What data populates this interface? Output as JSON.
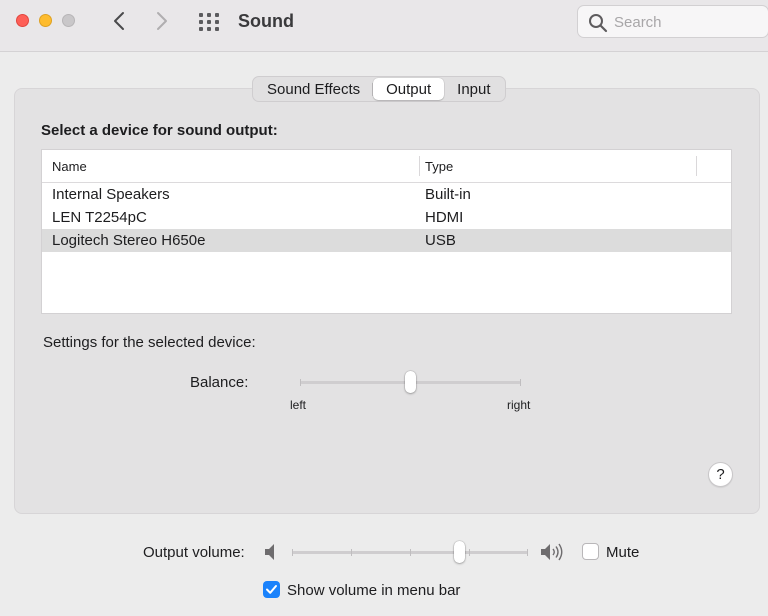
{
  "window": {
    "title": "Sound",
    "search_placeholder": "Search"
  },
  "icons": {
    "close": "close-traffic-light",
    "minimize": "minimize-traffic-light",
    "zoom": "zoom-traffic-light-disabled",
    "back": "chevron-left-icon",
    "forward": "chevron-right-icon",
    "show_all": "grid-icon",
    "search": "search-icon",
    "speaker_low": "speaker-low-icon",
    "speaker_high": "speaker-high-icon",
    "help": "question-mark-icon"
  },
  "tabs": [
    {
      "label": "Sound Effects",
      "active": false
    },
    {
      "label": "Output",
      "active": true
    },
    {
      "label": "Input",
      "active": false
    }
  ],
  "output": {
    "heading": "Select a device for sound output:",
    "columns": [
      "Name",
      "Type"
    ],
    "devices": [
      {
        "name": "Internal Speakers",
        "type": "Built-in",
        "selected": false
      },
      {
        "name": "LEN T2254pC",
        "type": "HDMI",
        "selected": false
      },
      {
        "name": "Logitech Stereo H650e",
        "type": "USB",
        "selected": true
      }
    ],
    "settings_label": "Settings for the selected device:",
    "balance": {
      "label": "Balance:",
      "left_label": "left",
      "right_label": "right",
      "value": 0.5
    },
    "help_label": "?"
  },
  "volume": {
    "label": "Output volume:",
    "value": 0.71,
    "mute_label": "Mute",
    "muted": false,
    "show_in_menu_bar_label": "Show volume in menu bar",
    "show_in_menu_bar": true
  },
  "colors": {
    "close": "#fe5f57",
    "minimize": "#febc2e",
    "zoom": "#c9c7c9",
    "accent": "#1a82fb",
    "selected_row": "#dcdcdc"
  }
}
